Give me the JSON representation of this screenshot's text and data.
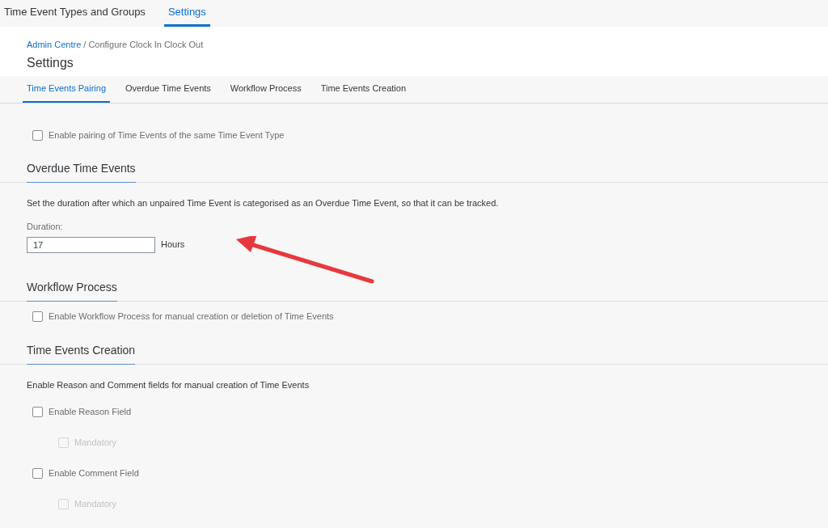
{
  "top_tabs": [
    {
      "label": "Time Event Types and Groups",
      "selected": false
    },
    {
      "label": "Settings",
      "selected": true
    }
  ],
  "breadcrumb": {
    "link": "Admin Centre",
    "current": "/ Configure Clock In Clock Out"
  },
  "page_title": "Settings",
  "section_tabs": [
    {
      "label": "Time Events Pairing",
      "selected": true
    },
    {
      "label": "Overdue Time Events",
      "selected": false
    },
    {
      "label": "Workflow Process",
      "selected": false
    },
    {
      "label": "Time Events Creation",
      "selected": false
    }
  ],
  "blocks": [
    {
      "kind": "checkbox",
      "label": "Enable pairing of Time Events of the same Time Event Type",
      "checked": false,
      "disabled": false
    },
    {
      "kind": "heading",
      "label": "Overdue Time Events"
    },
    {
      "kind": "text",
      "label": "Set the duration after which an unpaired Time Event is categorised as an Overdue Time Event, so that it can be tracked."
    },
    {
      "kind": "duration",
      "label": "Duration:",
      "value": "17",
      "unit": "Hours"
    },
    {
      "kind": "heading",
      "label": "Workflow Process"
    },
    {
      "kind": "checkbox",
      "label": "Enable Workflow Process for manual creation or deletion of Time Events",
      "checked": false,
      "disabled": false
    },
    {
      "kind": "heading",
      "label": "Time Events Creation"
    },
    {
      "kind": "text",
      "label": "Enable Reason and Comment fields for manual creation of Time Events"
    },
    {
      "kind": "checkbox",
      "label": "Enable Reason Field",
      "checked": false,
      "disabled": false,
      "children": [
        {
          "label": "Mandatory",
          "checked": false,
          "disabled": true
        }
      ]
    },
    {
      "kind": "checkbox",
      "label": "Enable Comment Field",
      "checked": false,
      "disabled": false,
      "children": [
        {
          "label": "Mandatory",
          "checked": false,
          "disabled": true
        }
      ]
    }
  ]
}
